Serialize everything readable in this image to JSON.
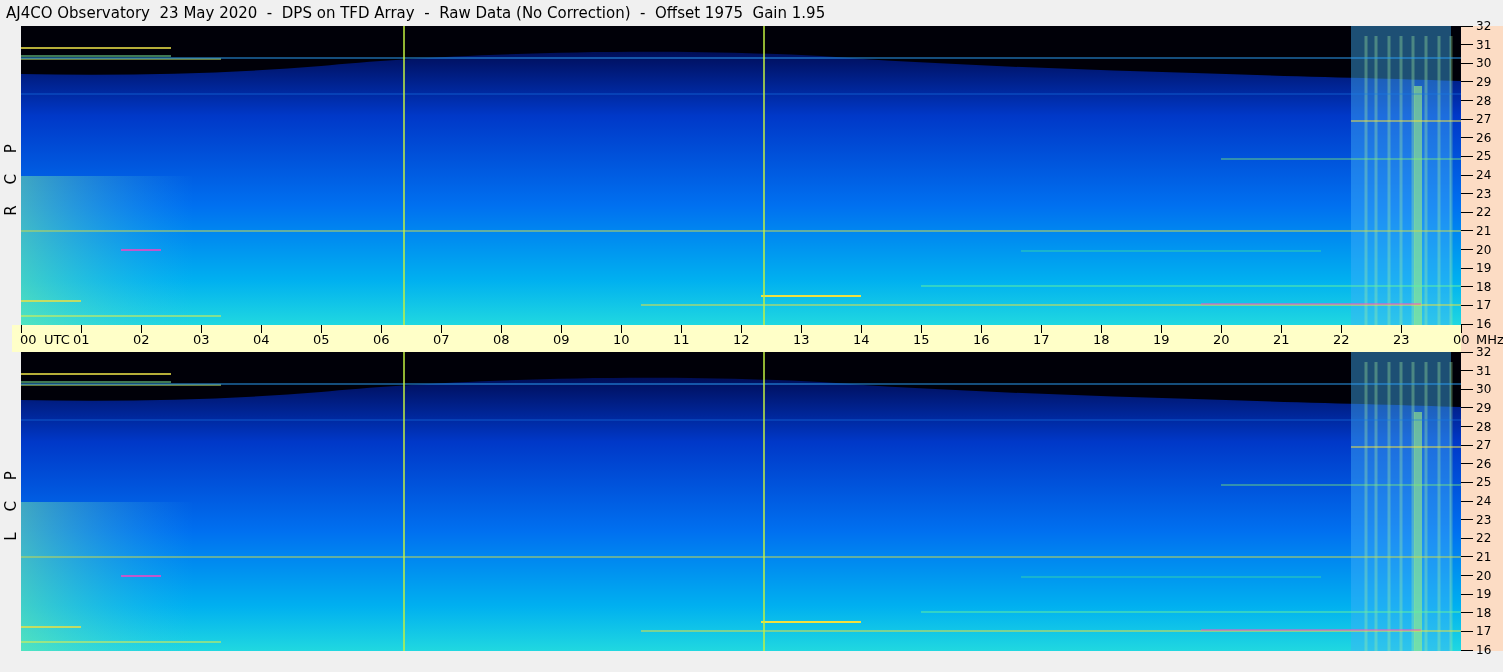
{
  "title": "AJ4CO Observatory  23 May 2020  -  DPS on TFD Array  -  Raw Data (No Correction)  -  Offset 1975  Gain 1.95",
  "panels": [
    {
      "label": "R C P",
      "freq_ticks": [
        "32",
        "31",
        "30",
        "29",
        "28",
        "27",
        "26",
        "25",
        "24",
        "23",
        "22",
        "21",
        "20",
        "19",
        "18",
        "17",
        "16"
      ]
    },
    {
      "label": "L C P",
      "freq_ticks": [
        "32",
        "31",
        "30",
        "29",
        "28",
        "27",
        "26",
        "25",
        "24",
        "23",
        "22",
        "21",
        "20",
        "19",
        "18",
        "17",
        "16"
      ]
    }
  ],
  "time_axis": {
    "ticks": [
      "00",
      "01",
      "02",
      "03",
      "04",
      "05",
      "06",
      "07",
      "08",
      "09",
      "10",
      "11",
      "12",
      "13",
      "14",
      "15",
      "16",
      "17",
      "18",
      "19",
      "20",
      "21",
      "22",
      "23",
      "00"
    ],
    "start_unit": "UTC",
    "end_unit": "MHz"
  }
}
